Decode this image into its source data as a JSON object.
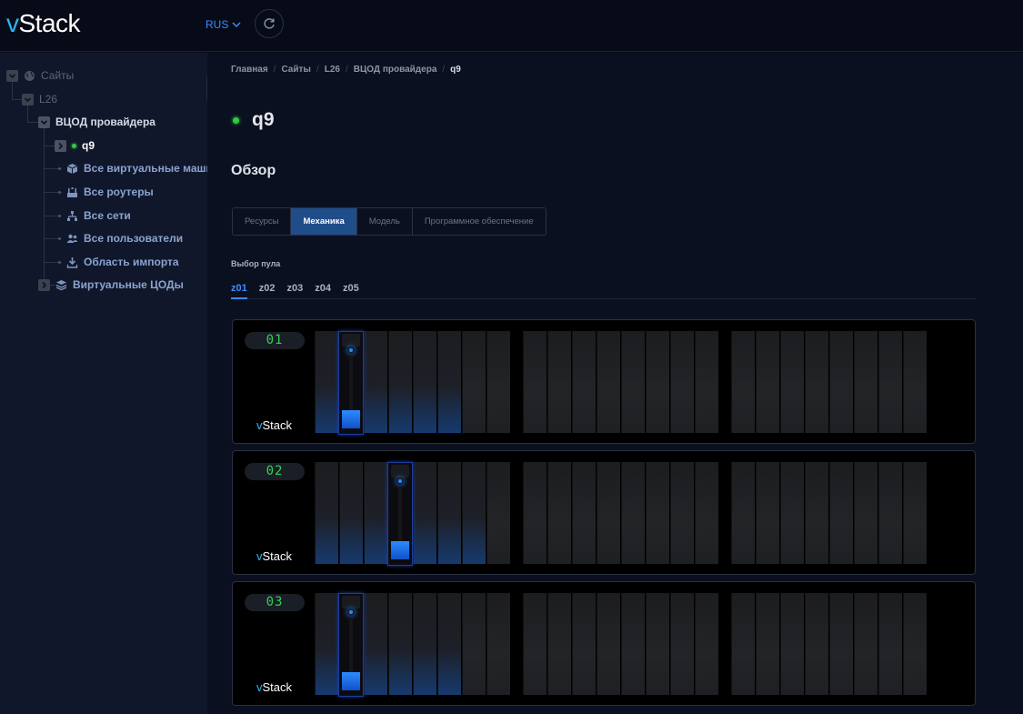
{
  "header": {
    "logo_v": "v",
    "logo_rest": "Stack",
    "language": "RUS"
  },
  "sidebar": {
    "items": [
      {
        "label": "Сайты"
      },
      {
        "label": "L26"
      },
      {
        "label": "ВЦОД провайдера"
      },
      {
        "label": "q9"
      },
      {
        "label": "Все виртуальные машины"
      },
      {
        "label": "Все роутеры"
      },
      {
        "label": "Все сети"
      },
      {
        "label": "Все пользователи"
      },
      {
        "label": "Область импорта"
      },
      {
        "label": "Виртуальные ЦОДы"
      }
    ]
  },
  "breadcrumb": [
    "Главная",
    "Сайты",
    "L26",
    "ВЦОД провайдера",
    "q9"
  ],
  "page": {
    "title": "q9",
    "section": "Обзор",
    "status_color": "#2ecc40"
  },
  "tabs": [
    "Ресурсы",
    "Механика",
    "Модель",
    "Программное обеспечение"
  ],
  "active_tab": "Механика",
  "pool": {
    "label": "Выбор пула",
    "options": [
      "z01",
      "z02",
      "z03",
      "z04",
      "z05"
    ],
    "selected": "z01"
  },
  "racks": [
    {
      "number": "01",
      "logo_v": "v",
      "logo_rest": "Stack",
      "arm_slot": 2,
      "lit_slots": 6
    },
    {
      "number": "02",
      "logo_v": "v",
      "logo_rest": "Stack",
      "arm_slot": 4,
      "lit_slots": 7
    },
    {
      "number": "03",
      "logo_v": "v",
      "logo_rest": "Stack",
      "arm_slot": 2,
      "lit_slots": 6
    }
  ],
  "colors": {
    "accent": "#3d8bfd",
    "active_tab_bg": "#1f4d8a",
    "led_green": "#30d158",
    "arm_blue": "#2b87ff"
  }
}
